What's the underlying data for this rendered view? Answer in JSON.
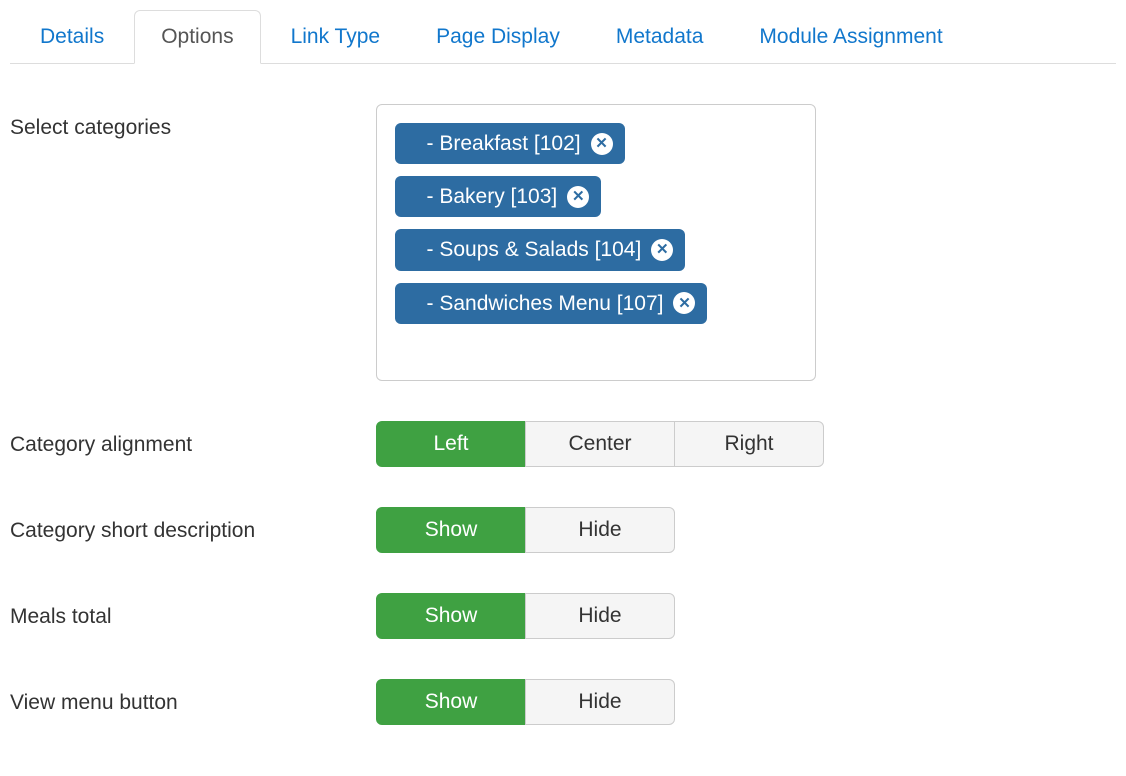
{
  "tabs": {
    "details": "Details",
    "options": "Options",
    "link_type": "Link Type",
    "page_display": "Page Display",
    "metadata": "Metadata",
    "module_assignment": "Module Assignment",
    "active": "options"
  },
  "labels": {
    "select_categories": "Select categories",
    "category_alignment": "Category alignment",
    "category_short_description": "Category short description",
    "meals_total": "Meals total",
    "view_menu_button": "View menu button"
  },
  "categories": [
    {
      "label": "   - Breakfast [102]"
    },
    {
      "label": "   - Bakery [103]"
    },
    {
      "label": "   - Soups & Salads [104]"
    },
    {
      "label": "   - Sandwiches Menu [107]"
    }
  ],
  "alignment": {
    "options": {
      "left": "Left",
      "center": "Center",
      "right": "Right"
    },
    "selected": "left"
  },
  "show_hide": {
    "show": "Show",
    "hide": "Hide"
  },
  "category_short_description": "show",
  "meals_total": "show",
  "view_menu_button": "show"
}
